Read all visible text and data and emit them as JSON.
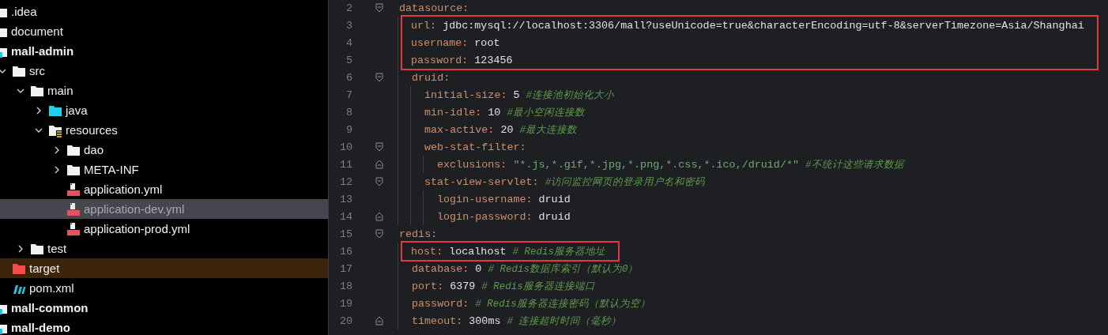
{
  "sidebar": {
    "items": [
      {
        "label": ".idea",
        "kind": "folder",
        "selected": false
      },
      {
        "label": "document",
        "kind": "folder",
        "selected": false
      },
      {
        "label": "mall-admin",
        "kind": "module",
        "selected": false,
        "children": [
          {
            "label": "src",
            "kind": "folder",
            "selected": false,
            "expanded": true,
            "children": [
              {
                "label": "main",
                "kind": "folder",
                "selected": false,
                "expanded": true,
                "children": [
                  {
                    "label": "java",
                    "kind": "source-folder",
                    "selected": false,
                    "expanded": false
                  },
                  {
                    "label": "resources",
                    "kind": "resource-folder",
                    "selected": false,
                    "expanded": true,
                    "children": [
                      {
                        "label": "dao",
                        "kind": "folder",
                        "selected": false,
                        "expanded": false
                      },
                      {
                        "label": "META-INF",
                        "kind": "folder",
                        "selected": false,
                        "expanded": false
                      },
                      {
                        "label": "application.yml",
                        "kind": "yml",
                        "selected": false
                      },
                      {
                        "label": "application-dev.yml",
                        "kind": "yml",
                        "selected": true
                      },
                      {
                        "label": "application-prod.yml",
                        "kind": "yml",
                        "selected": false
                      }
                    ]
                  }
                ]
              },
              {
                "label": "test",
                "kind": "folder",
                "selected": false,
                "expanded": false
              }
            ]
          },
          {
            "label": "target",
            "kind": "excluded-folder",
            "selected": false
          },
          {
            "label": "pom.xml",
            "kind": "maven",
            "selected": false
          }
        ]
      },
      {
        "label": "mall-common",
        "kind": "module",
        "selected": false
      },
      {
        "label": "mall-demo",
        "kind": "module",
        "selected": false
      }
    ]
  },
  "editor": {
    "lines": [
      {
        "number": "2",
        "key": "datasource:",
        "fold_start": true,
        "highlighted": false,
        "children": [
          {
            "number": "3",
            "key": "url:",
            "value": "jdbc:mysql://localhost:3306/mall?useUnicode=true&characterEncoding=utf-8&serverTimezone=Asia/Shanghai",
            "quoted": false,
            "highlighted": true
          },
          {
            "number": "4",
            "key": "username:",
            "value": "root",
            "quoted": false,
            "highlighted": true
          },
          {
            "number": "5",
            "key": "password:",
            "value": "123456",
            "quoted": false,
            "highlighted": true
          },
          {
            "number": "6",
            "key": "druid:",
            "fold_start": true,
            "highlighted": false,
            "children": [
              {
                "number": "7",
                "key": "initial-size:",
                "value": "5",
                "quoted": false,
                "comment": "#连接池初始化大小",
                "highlighted": false
              },
              {
                "number": "8",
                "key": "min-idle:",
                "value": "10",
                "quoted": false,
                "comment": "#最小空闲连接数",
                "highlighted": false
              },
              {
                "number": "9",
                "key": "max-active:",
                "value": "20",
                "quoted": false,
                "comment": "#最大连接数",
                "highlighted": false
              },
              {
                "number": "10",
                "key": "web-stat-filter:",
                "fold_start": true,
                "highlighted": false,
                "children": [
                  {
                    "number": "11",
                    "key": "exclusions:",
                    "value": "\"*.js,*.gif,*.jpg,*.png,*.css,*.ico,/druid/*\"",
                    "quoted": true,
                    "comment": "#不统计这些请求数据",
                    "fold_end": true,
                    "highlighted": false
                  }
                ]
              },
              {
                "number": "12",
                "key": "stat-view-servlet:",
                "comment": "#访问监控网页的登录用户名和密码",
                "fold_start": true,
                "highlighted": false,
                "children": [
                  {
                    "number": "13",
                    "key": "login-username:",
                    "value": "druid",
                    "quoted": false,
                    "highlighted": false
                  },
                  {
                    "number": "14",
                    "key": "login-password:",
                    "value": "druid",
                    "quoted": false,
                    "fold_end": true,
                    "highlighted": false
                  }
                ]
              }
            ]
          }
        ]
      },
      {
        "number": "15",
        "key": "redis:",
        "fold_start": true,
        "highlighted": false,
        "children": [
          {
            "number": "16",
            "key": "host:",
            "value": "localhost",
            "quoted": false,
            "comment": "# Redis服务器地址",
            "highlighted": true
          },
          {
            "number": "17",
            "key": "database:",
            "value": "0",
            "quoted": false,
            "comment": "# Redis数据库索引（默认为0）",
            "highlighted": false
          },
          {
            "number": "18",
            "key": "port:",
            "value": "6379",
            "quoted": false,
            "comment": "# Redis服务器连接端口",
            "highlighted": false
          },
          {
            "number": "19",
            "key": "password:",
            "comment": "# Redis服务器连接密码（默认为空）",
            "highlighted": false
          },
          {
            "number": "20",
            "key": "timeout:",
            "value": "300ms",
            "quoted": false,
            "comment": "# 连接超时时间（毫秒）",
            "fold_end": true,
            "highlighted": false
          }
        ]
      }
    ]
  }
}
